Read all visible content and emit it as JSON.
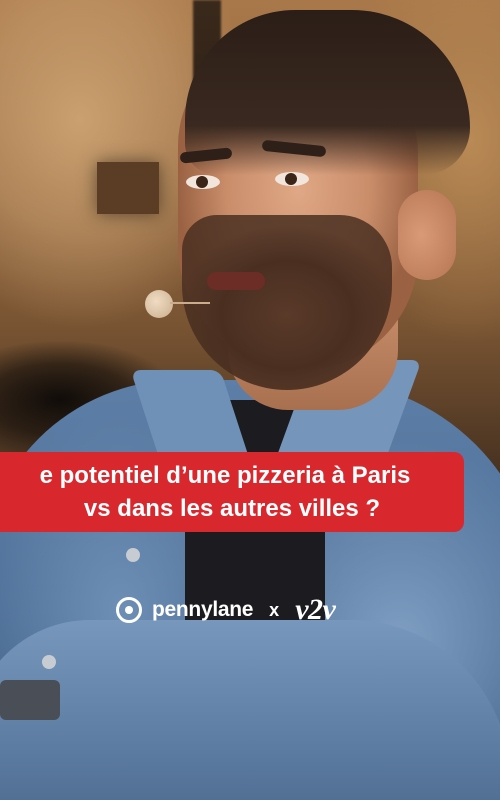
{
  "scene": {
    "description_label": "Interview video frame",
    "colors": {
      "caption_background": "#d8282e",
      "caption_text": "#ffffff",
      "brand_text": "#ffffff"
    }
  },
  "caption": {
    "line1": "e potentiel d’une pizzeria à Paris",
    "line2": "vs dans les autres villes ?"
  },
  "branding": {
    "partner1_icon": "pennylane-logo-icon",
    "partner1_name": "pennylane",
    "separator": "x",
    "partner2_name": "v2v"
  }
}
